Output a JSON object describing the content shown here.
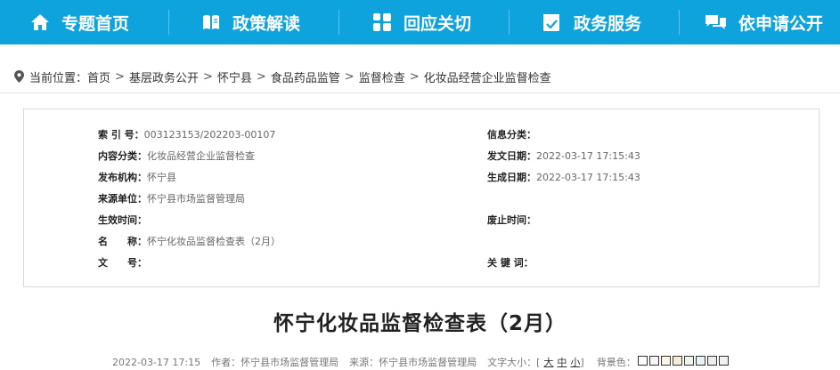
{
  "nav": {
    "items": [
      {
        "label": "专题首页",
        "icon": "home-icon"
      },
      {
        "label": "政策解读",
        "icon": "book-icon"
      },
      {
        "label": "回应关切",
        "icon": "grid-icon"
      },
      {
        "label": "政务服务",
        "icon": "checkbox-icon"
      },
      {
        "label": "依申请公开",
        "icon": "chat-icon"
      }
    ]
  },
  "breadcrumb": {
    "prefix": "当前位置：",
    "items": [
      "首页",
      "基层政务公开",
      "怀宁县",
      "食品药品监管",
      "监督检查",
      "化妆品经营企业监督检查"
    ],
    "separator": ">"
  },
  "info": {
    "index_label": "索 引 号：",
    "index_value": "003123153/202203-00107",
    "category_label": "信息分类：",
    "category_value": "",
    "content_label": "内容分类：",
    "content_value": "化妆品经营企业监督检查",
    "issued_label": "发文日期：",
    "issued_value": "2022-03-17 17:15:43",
    "publisher_label": "发布机构：",
    "publisher_value": "怀宁县",
    "generated_label": "生成日期：",
    "generated_value": "2022-03-17 17:15:43",
    "source_label": "来源单位：",
    "source_value": "怀宁县市场监督管理局",
    "effective_label": "生效时间：",
    "effective_value": "",
    "expired_label": "废止时间：",
    "expired_value": "",
    "name_label_a": "名",
    "name_label_b": "称：",
    "name_value": "怀宁化妆品监督检查表（2月）",
    "docno_label_a": "文",
    "docno_label_b": "号：",
    "docno_value": "",
    "keywords_label": "关 键 词：",
    "keywords_value": ""
  },
  "title": "怀宁化妆品监督检查表（2月）",
  "meta": {
    "datetime": "2022-03-17 17:15",
    "author": "作者：怀宁县市场监督管理局",
    "source": "来源：怀宁县市场监督管理局",
    "fontsize_label": "文字大小：[",
    "fontsize_large": "大",
    "fontsize_medium": "中",
    "fontsize_small": "小",
    "fontsize_end": "]",
    "bg_label": "背景色：",
    "bg_colors": [
      "#ffffff",
      "#f5f5f5",
      "#fbf6e8",
      "#f4ecd6",
      "#eef5ea",
      "#e6f2f6",
      "#ececec",
      "#f2f2f2"
    ]
  }
}
